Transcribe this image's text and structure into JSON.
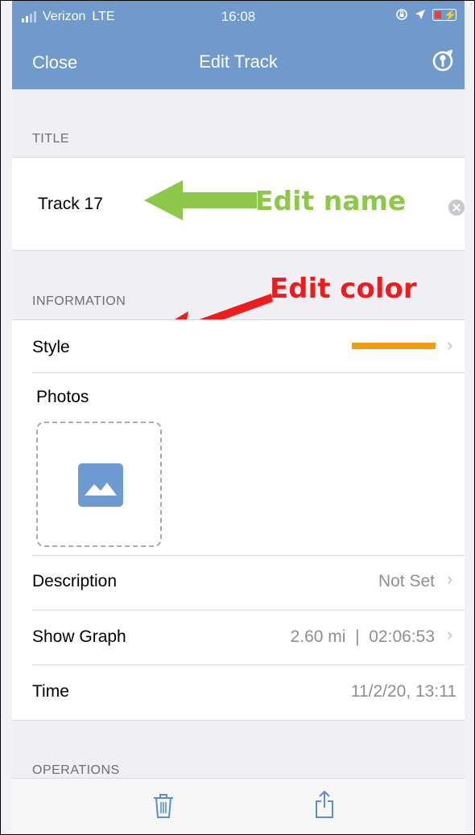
{
  "status_bar": {
    "carrier": "Verizon",
    "network": "LTE",
    "time": "16:08"
  },
  "nav": {
    "close_label": "Close",
    "title": "Edit Track",
    "right_icon": "key-icon"
  },
  "title_section": {
    "header": "TITLE",
    "value": "Track 17"
  },
  "annotations": {
    "edit_name": "Edit name",
    "edit_color": "Edit color",
    "name_arrow_color": "#8dc84a",
    "color_arrow_color": "#ee1c1c"
  },
  "information": {
    "header": "INFORMATION",
    "style_label": "Style",
    "style_color": "#f39c12",
    "photos_label": "Photos",
    "description_label": "Description",
    "description_value": "Not Set",
    "graph_label": "Show Graph",
    "graph_value": "2.60 mi  |  02:06:53",
    "time_label": "Time",
    "time_value": "11/2/20, 13:11"
  },
  "operations": {
    "header": "OPERATIONS"
  },
  "toolbar": {
    "trash_icon": "trash-icon",
    "share_icon": "share-icon"
  },
  "colors": {
    "nav_bg": "#6f9acb",
    "page_bg": "#efeff4",
    "accent_blue": "#6d9ad0"
  }
}
